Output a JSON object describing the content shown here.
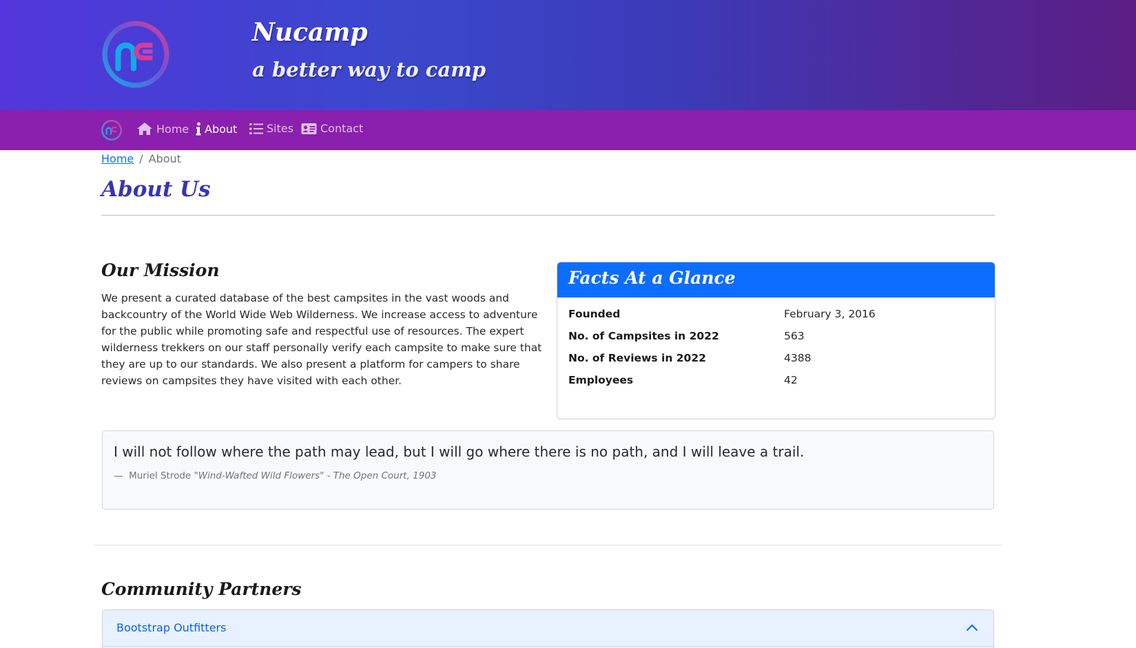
{
  "header": {
    "brand_title": "Nucamp",
    "brand_subtitle": "a better way to camp",
    "logo_icon": "nucamp-logo-icon"
  },
  "nav": {
    "items": [
      {
        "label": "Home",
        "icon": "home-icon",
        "active": false
      },
      {
        "label": "About",
        "icon": "info-icon",
        "active": true
      },
      {
        "label": "Sites",
        "icon": "list-icon",
        "active": false
      },
      {
        "label": "Contact",
        "icon": "address-card-icon",
        "active": false
      }
    ]
  },
  "breadcrumb": {
    "home_label": "Home",
    "separator": "/",
    "current_label": "About"
  },
  "page": {
    "title": "About Us"
  },
  "mission": {
    "heading": "Our Mission",
    "text": "We present a curated database of the best campsites in the vast woods and backcountry of the World Wide Web Wilderness. We increase access to adventure for the public while promoting safe and respectful use of resources. The expert wilderness trekkers on our staff personally verify each campsite to make sure that they are up to our standards. We also present a platform for campers to share reviews on campsites they have visited with each other."
  },
  "facts": {
    "heading": "Facts At a Glance",
    "rows": [
      {
        "label": "Founded",
        "value": "February 3, 2016"
      },
      {
        "label": "No. of Campsites in 2022",
        "value": "563"
      },
      {
        "label": "No. of Reviews in 2022",
        "value": "4388"
      },
      {
        "label": "Employees",
        "value": "42"
      }
    ]
  },
  "quote": {
    "text": "I will not follow where the path may lead, but I will go where there is no path, and I will leave a trail.",
    "dash": "—",
    "author": "Muriel Strode",
    "source": "\"Wind-Wafted Wild Flowers\" - The Open Court, 1903"
  },
  "partners": {
    "heading": "Community Partners",
    "items": [
      {
        "name": "Bootstrap Outfitters",
        "expanded": true
      }
    ]
  },
  "colors": {
    "header_gradient_start": "#5236db",
    "header_gradient_end": "#5b1e84",
    "navbar": "#8b1fae",
    "title_blue": "#3535b5",
    "facts_header": "#0d6efd",
    "link": "#0d6efd"
  }
}
